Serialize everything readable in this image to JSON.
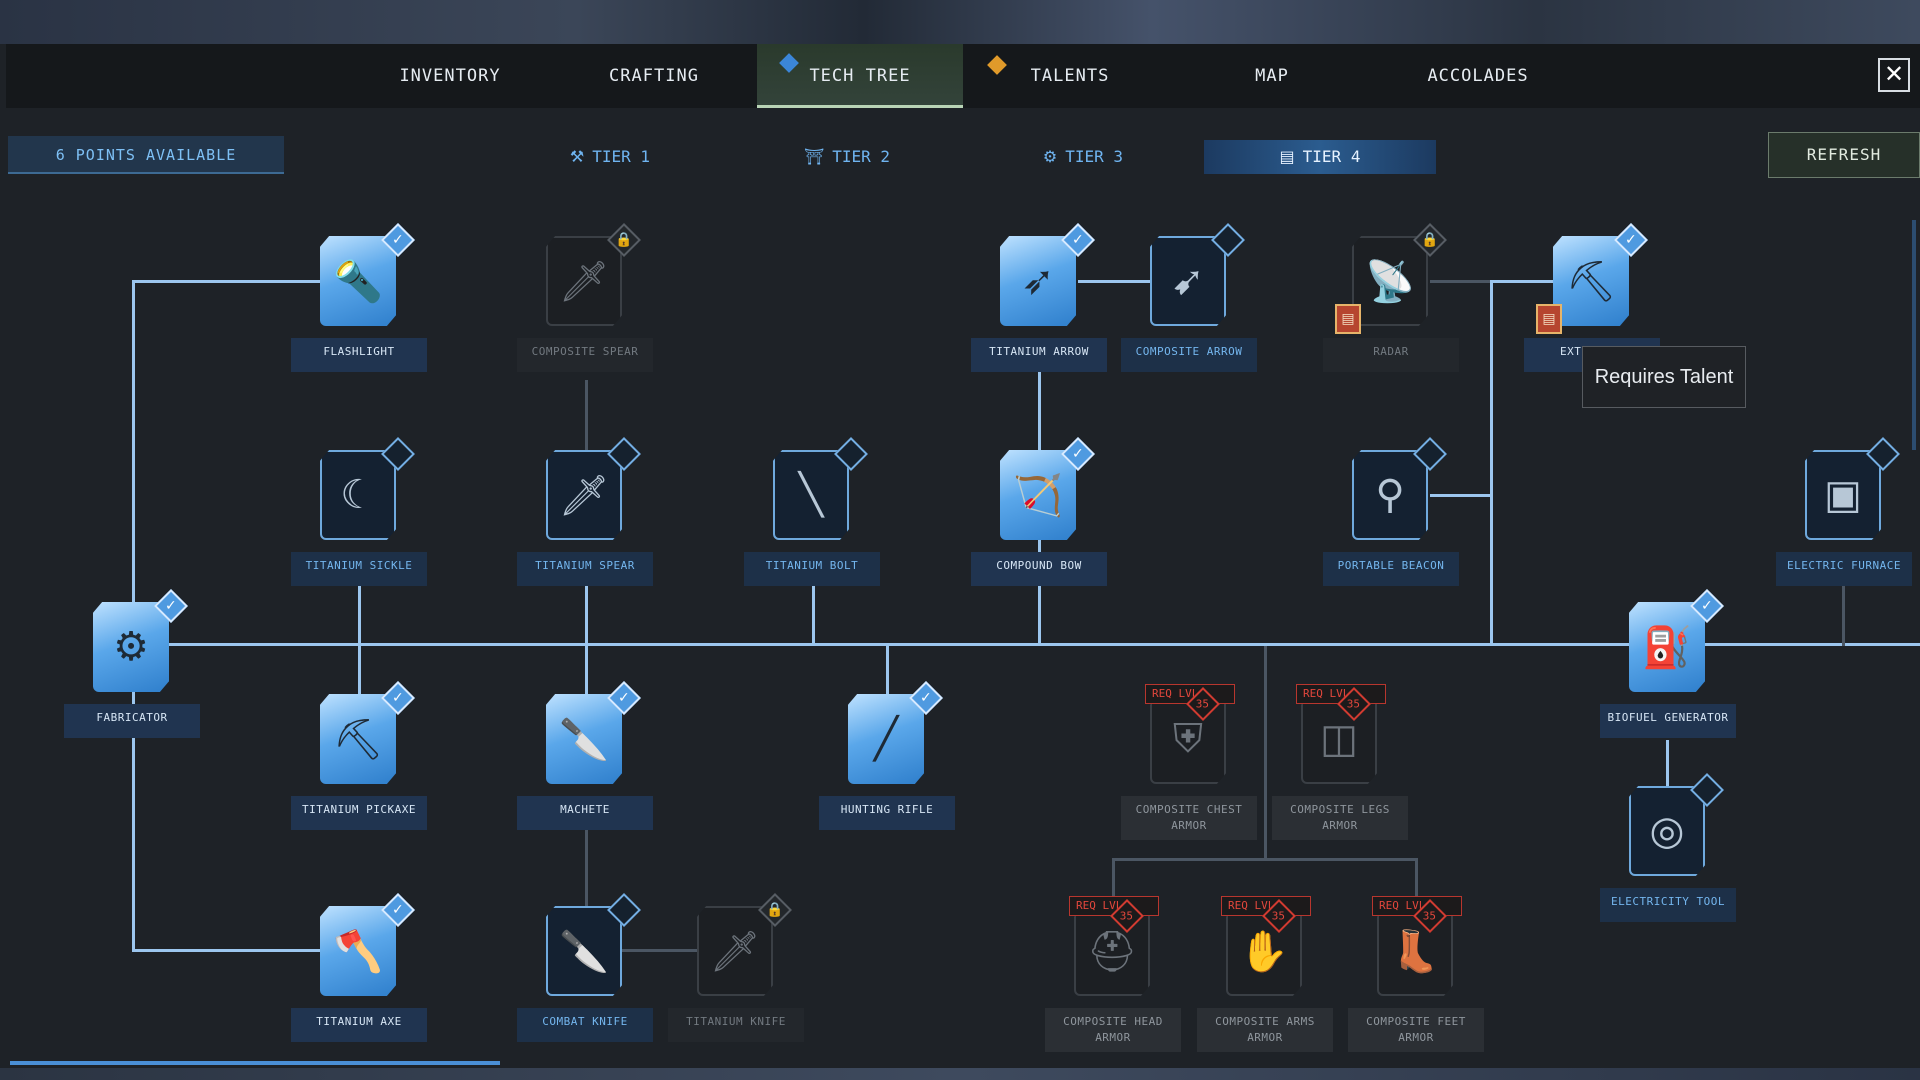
{
  "nav": {
    "tabs": [
      {
        "label": "INVENTORY"
      },
      {
        "label": "CRAFTING"
      },
      {
        "label": "TECH TREE"
      },
      {
        "label": "TALENTS"
      },
      {
        "label": "MAP"
      },
      {
        "label": "ACCOLADES"
      }
    ],
    "close_glyph": "✕"
  },
  "points_available": "6 POINTS AVAILABLE",
  "tiers": [
    "TIER 1",
    "TIER 2",
    "TIER 3",
    "TIER 4"
  ],
  "refresh_label": "REFRESH",
  "tooltip": "Requires Talent",
  "nodes": {
    "flashlight": "FLASHLIGHT",
    "composite_spear": "COMPOSITE SPEAR",
    "titanium_arrow": "TITANIUM ARROW",
    "composite_arrow": "COMPOSITE ARROW",
    "radar": "RADAR",
    "extractor": "EXT",
    "titanium_sickle": "TITANIUM SICKLE",
    "titanium_spear": "TITANIUM SPEAR",
    "titanium_bolt": "TITANIUM BOLT",
    "compound_bow": "COMPOUND BOW",
    "portable_beacon": "PORTABLE BEACON",
    "electric_furnace": "ELECTRIC FURNACE",
    "fabricator": "FABRICATOR",
    "titanium_pickaxe": "TITANIUM PICKAXE",
    "machete": "MACHETE",
    "hunting_rifle": "HUNTING RIFLE",
    "composite_chest_armor": "COMPOSITE CHEST ARMOR",
    "composite_legs_armor": "COMPOSITE LEGS ARMOR",
    "biofuel_generator": "BIOFUEL GENERATOR",
    "electricity_tool": "ELECTRICITY TOOL",
    "titanium_axe": "TITANIUM AXE",
    "combat_knife": "COMBAT KNIFE",
    "titanium_knife": "TITANIUM KNIFE",
    "composite_head_armor": "COMPOSITE HEAD ARMOR",
    "composite_arms_armor": "COMPOSITE ARMS ARMOR",
    "composite_feet_armor": "COMPOSITE FEET ARMOR"
  },
  "req_level": {
    "label": "REQ LVL",
    "value": "35"
  },
  "colors": {
    "accent": "#4f9ae0",
    "line": "#9cc6ee",
    "warning": "#e2473c",
    "alert_blue": "#3b86d9",
    "alert_orange": "#e09a2a"
  }
}
